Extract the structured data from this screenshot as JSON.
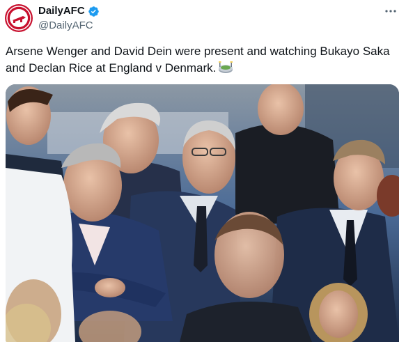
{
  "author": {
    "display_name": "DailyAFC",
    "handle": "@DailyAFC",
    "avatar_color": "#c8102e"
  },
  "tweet": {
    "text": "Arsene Wenger and David Dein were present and watching Bukayo Saka and Declan Rice at England v Denmark.",
    "emoji_icon": "stadium-icon"
  },
  "icons": {
    "verified": "verified-badge-icon",
    "more": "more-options-icon"
  },
  "colors": {
    "verified": "#1d9bf0",
    "secondary_text": "#536471"
  }
}
